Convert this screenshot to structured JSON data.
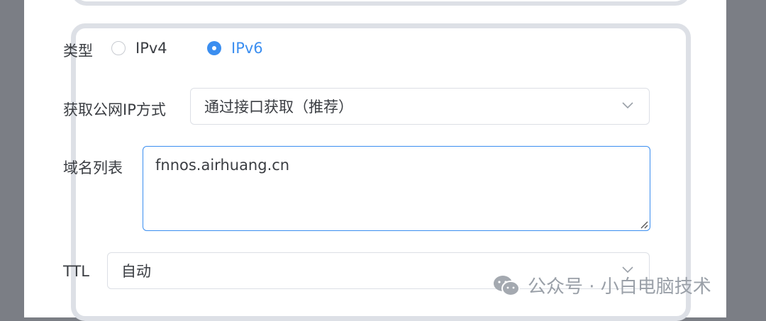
{
  "form": {
    "type_label": "类型",
    "type_options": [
      "IPv4",
      "IPv6"
    ],
    "type_selected": "IPv6",
    "ip_method_label": "获取公网IP方式",
    "ip_method_value": "通过接口获取（推荐）",
    "domain_list_label": "域名列表",
    "domain_list_value": "fnnos.airhuang.cn",
    "ttl_label": "TTL",
    "ttl_value": "自动"
  },
  "watermark": {
    "text": "公众号 · 小白电脑技术",
    "icon": "wechat-icon"
  },
  "colors": {
    "accent": "#3b8ef0",
    "card_border": "#dde0e6",
    "overlay": "#7b7e85"
  }
}
